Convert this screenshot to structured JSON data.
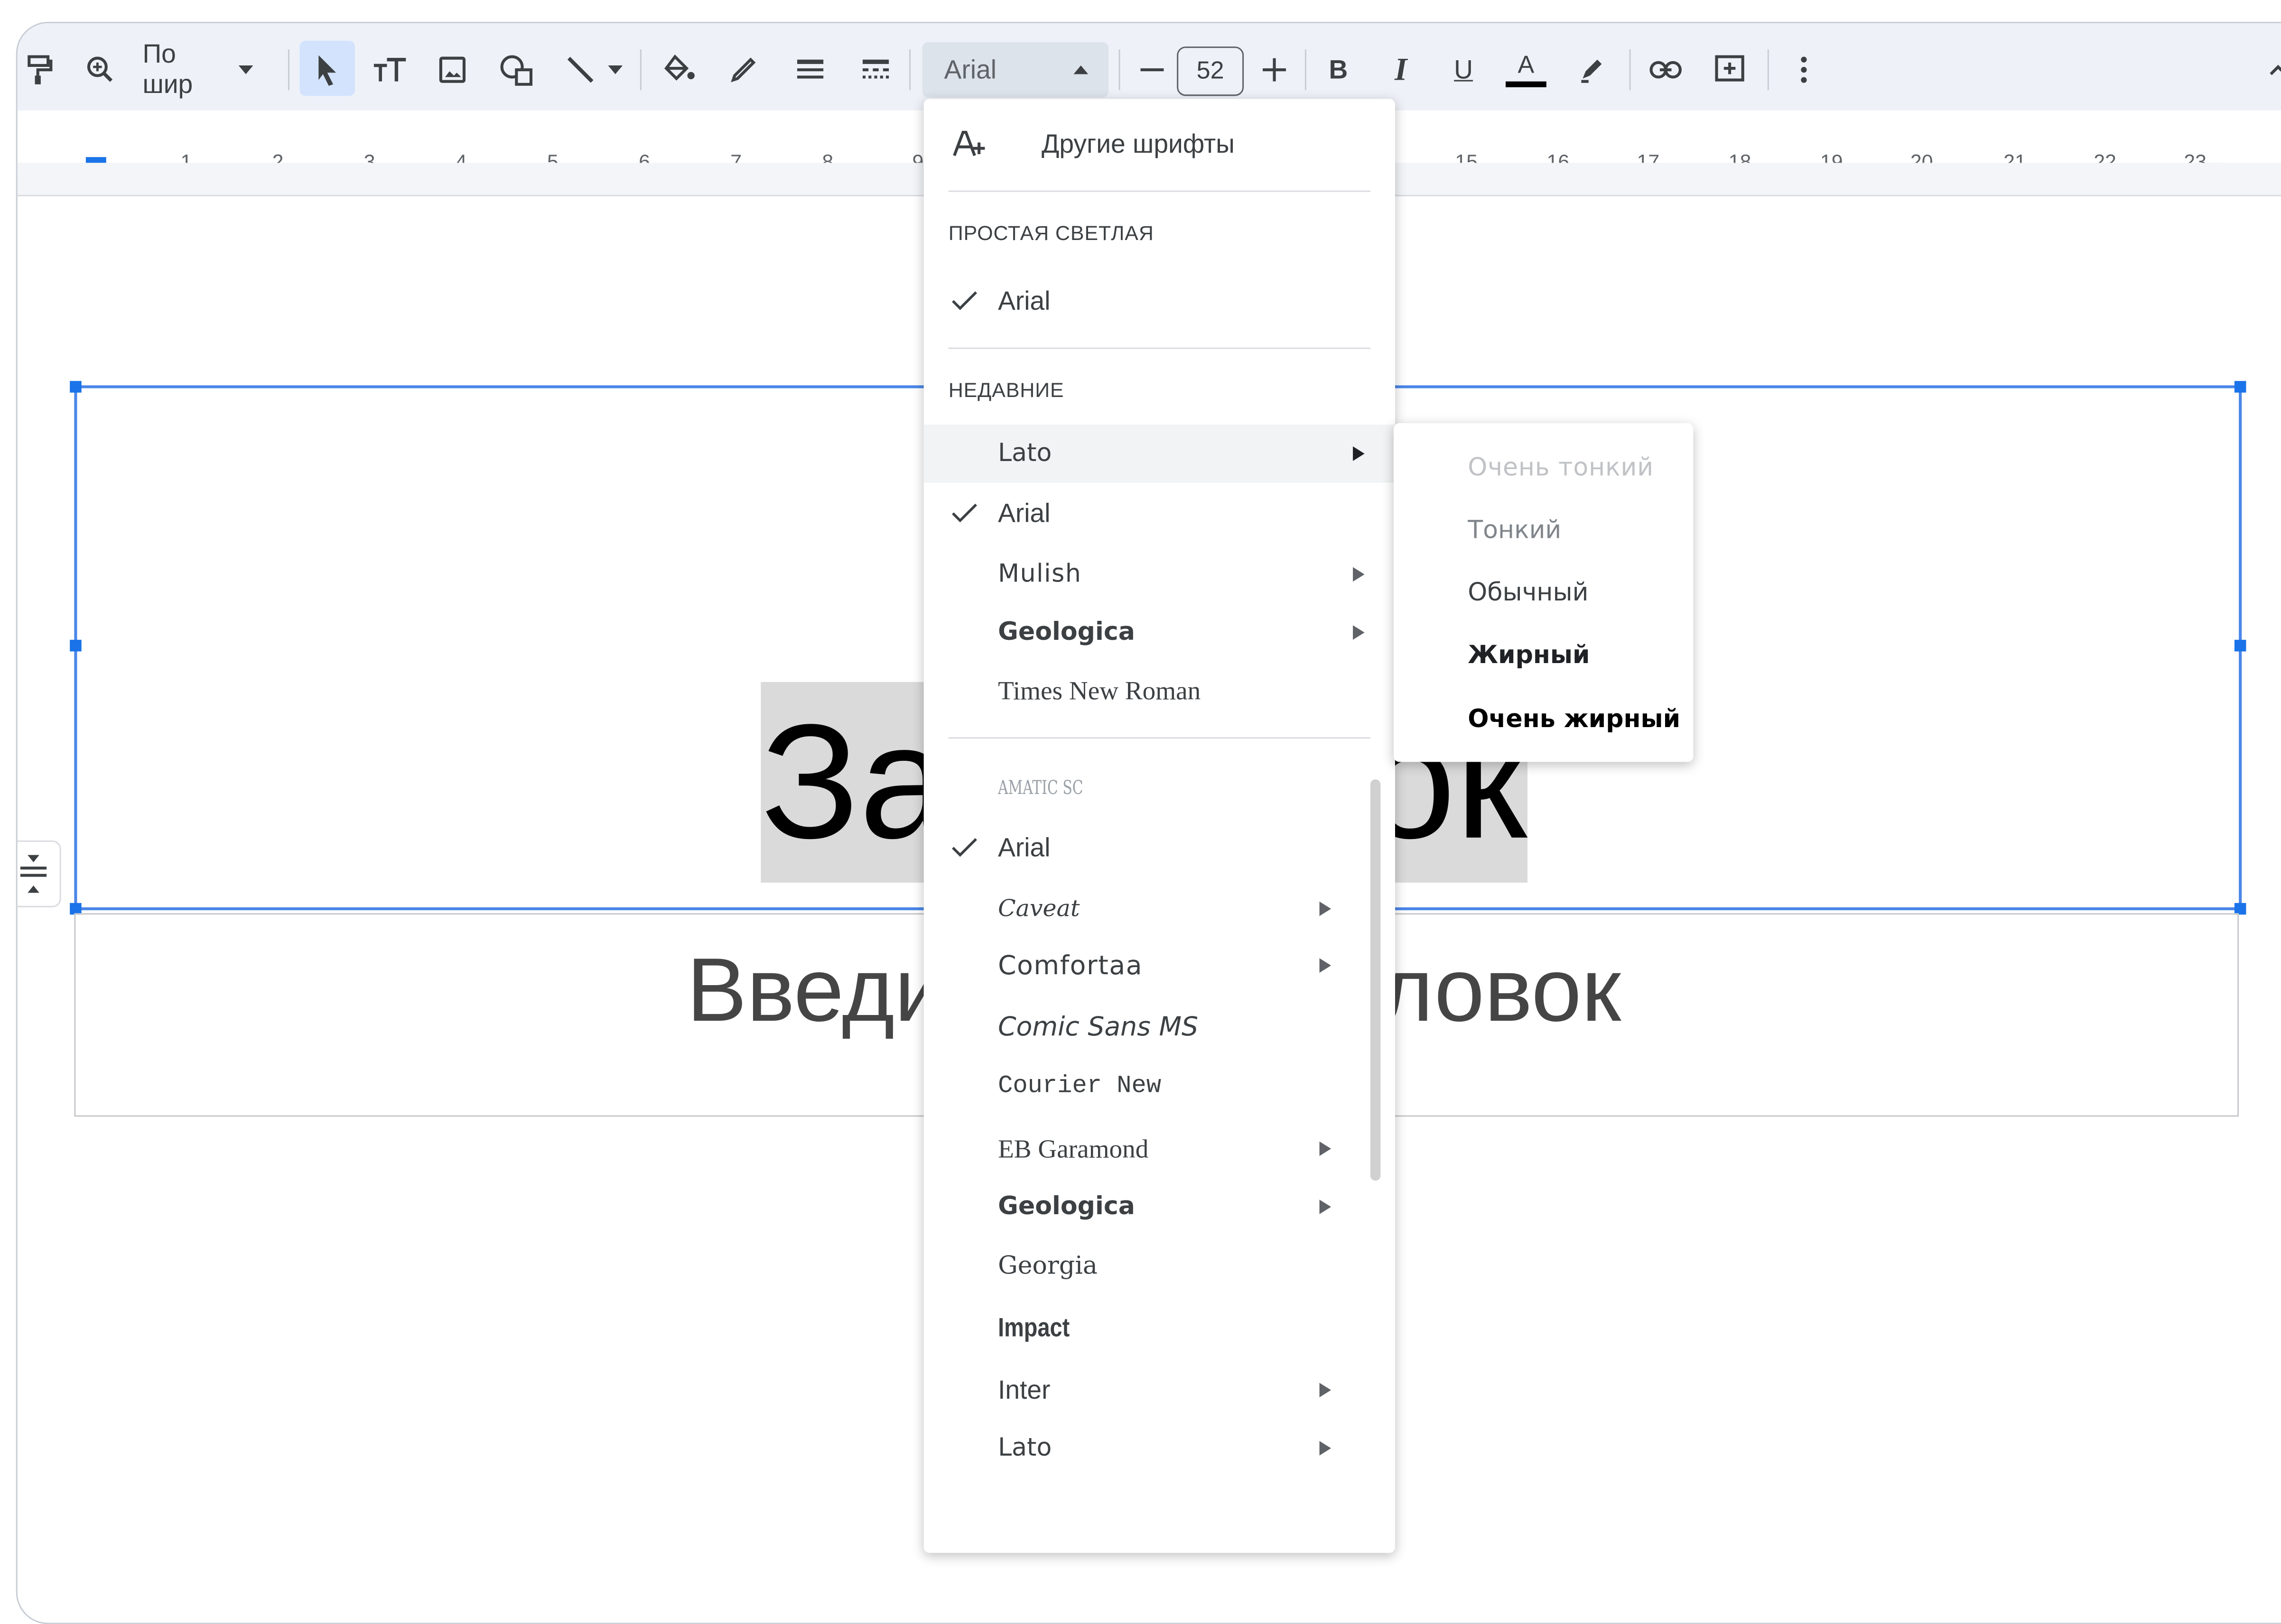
{
  "toolbar": {
    "zoom_label": "По шир",
    "font_name": "Arial",
    "font_size": "52",
    "bold": "B",
    "italic": "I",
    "underline": "U",
    "text_color": "A"
  },
  "ruler": {
    "numbers": [
      "1",
      "2",
      "3",
      "4",
      "5",
      "6",
      "7",
      "8",
      "9",
      "15",
      "16",
      "17",
      "18",
      "19",
      "20",
      "21",
      "22",
      "23"
    ]
  },
  "canvas": {
    "title": "Заголовок",
    "subtitle": "Введите подзаголовок"
  },
  "font_menu": {
    "more_fonts": "Другие шрифты",
    "section_theme": "ПРОСТАЯ СВЕТЛАЯ",
    "theme_font": "Arial",
    "section_recent": "НЕДАВНИЕ",
    "recent": [
      "Lato",
      "Arial",
      "Mulish",
      "Geologica",
      "Times New Roman"
    ],
    "all_fonts": [
      "AMATIC SC",
      "Arial",
      "Caveat",
      "Comfortaa",
      "Comic Sans MS",
      "Courier New",
      "EB Garamond",
      "Geologica",
      "Georgia",
      "Impact",
      "Inter",
      "Lato"
    ]
  },
  "weight_submenu": {
    "items": [
      "Очень тонкий",
      "Тонкий",
      "Обычный",
      "Жирный",
      "Очень жирный"
    ]
  },
  "colors": {
    "accent": "#1a73e8",
    "selection": "#d3e3fd",
    "toolbar_bg": "#eef2f8"
  }
}
